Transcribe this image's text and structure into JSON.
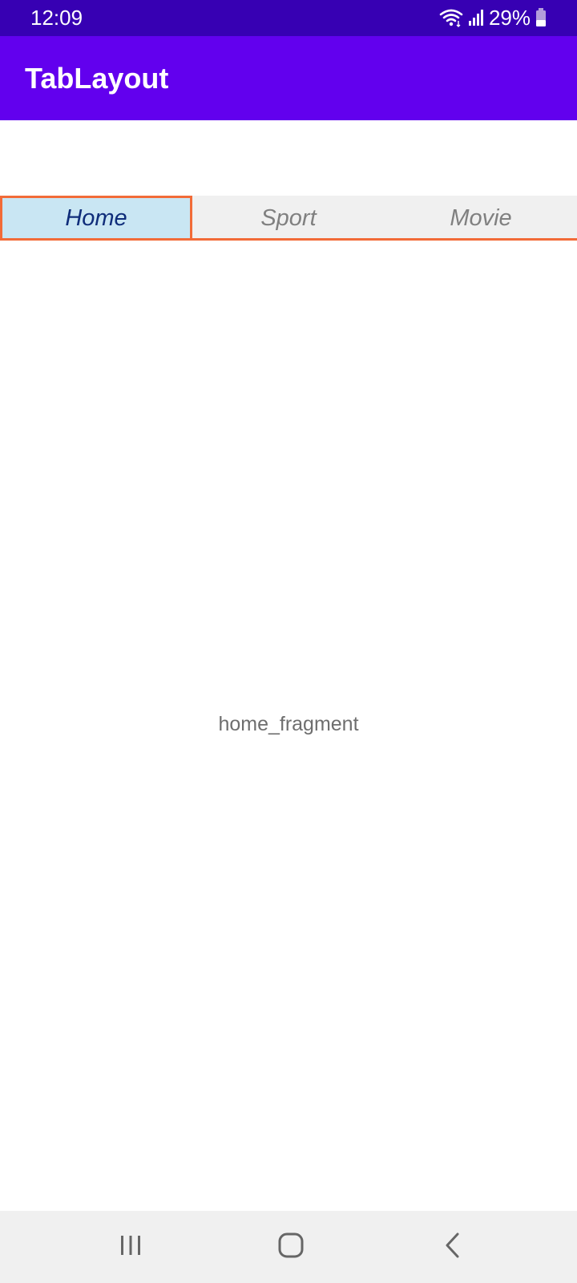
{
  "status_bar": {
    "time": "12:09",
    "battery_text": "29%",
    "icons": [
      "wifi-icon",
      "signal-icon",
      "battery-icon"
    ]
  },
  "app_bar": {
    "title": "TabLayout"
  },
  "tabs": [
    {
      "label": "Home",
      "selected": true
    },
    {
      "label": "Sport",
      "selected": false
    },
    {
      "label": "Movie",
      "selected": false
    }
  ],
  "content": {
    "text": "home_fragment"
  },
  "nav_bar": {
    "buttons": [
      "recents-icon",
      "home-icon",
      "back-icon"
    ]
  },
  "colors": {
    "status_bar": "#3700b3",
    "app_bar": "#6200ee",
    "tab_selected_bg": "#c9e6f3",
    "tab_indicator": "#f26b38",
    "tab_bg": "#f0f0f0"
  }
}
